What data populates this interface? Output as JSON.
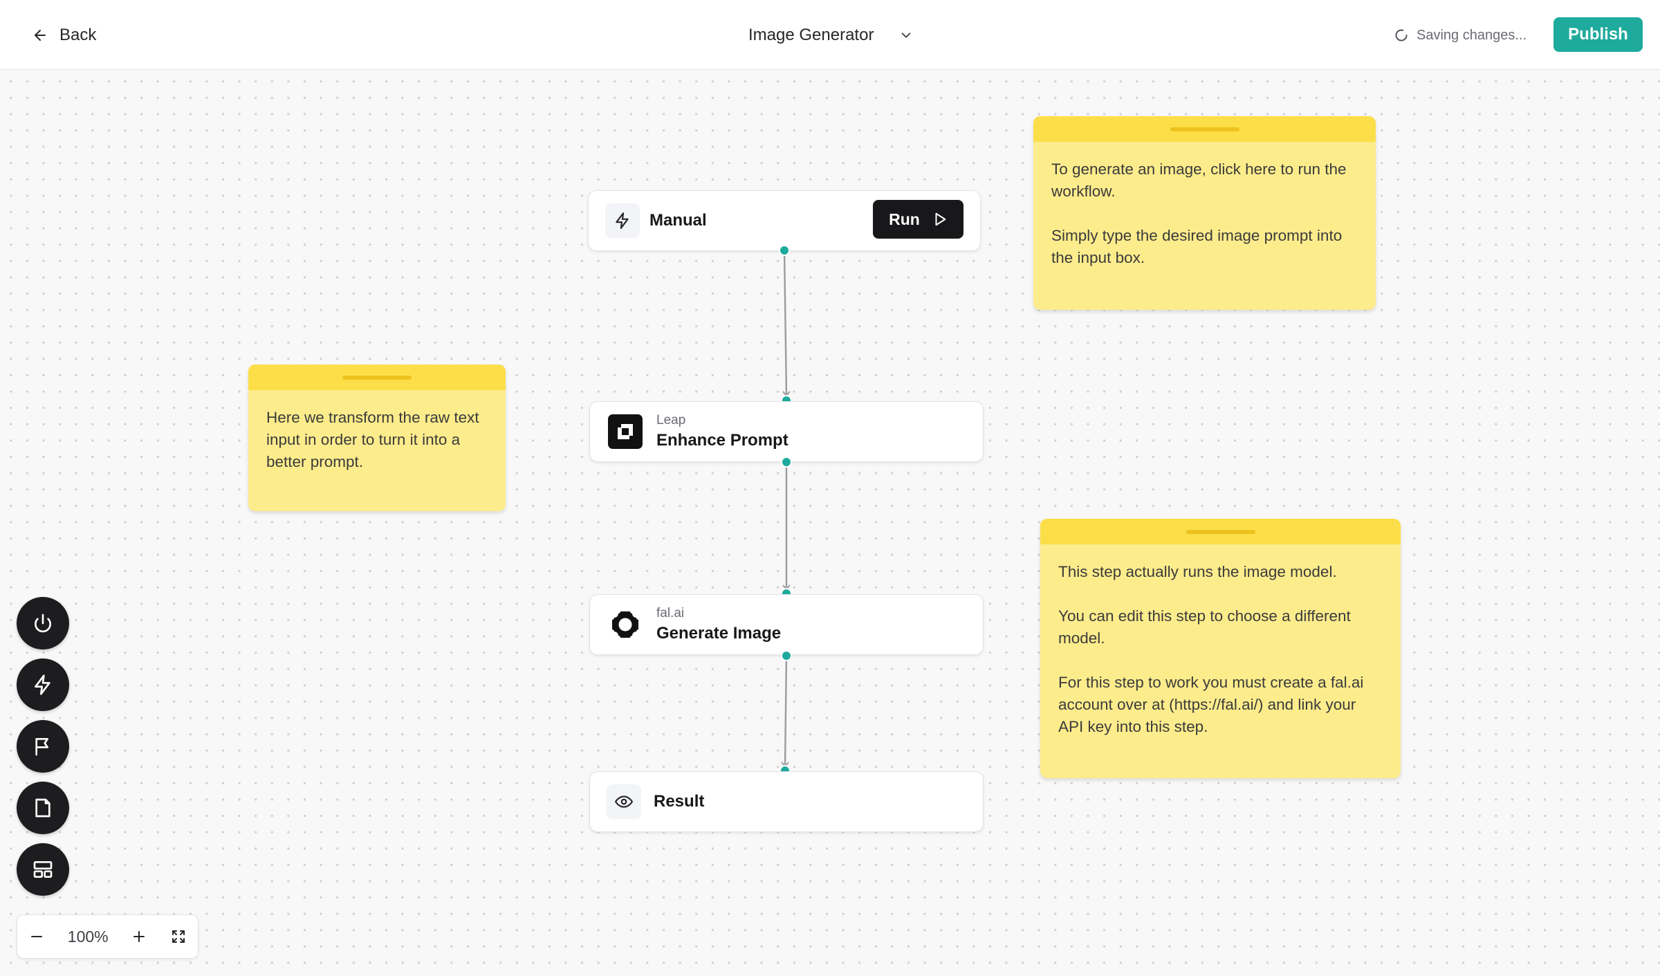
{
  "header": {
    "back_label": "Back",
    "workflow_title": "Image Generator",
    "status_text": "Saving changes...",
    "publish_label": "Publish"
  },
  "nodes": {
    "manual": {
      "label": "Manual",
      "run_label": "Run",
      "icon": "lightning-icon"
    },
    "enhance": {
      "provider": "Leap",
      "label": "Enhance Prompt",
      "icon": "leap-logo-icon"
    },
    "generate": {
      "provider": "fal.ai",
      "label": "Generate Image",
      "icon": "fal-logo-icon"
    },
    "result": {
      "label": "Result",
      "icon": "eye-icon"
    }
  },
  "notes": {
    "run_hint": "To generate an image, click here to run the workflow.\n\nSimply type the desired image prompt into the input box.",
    "transform_hint": "Here we transform the raw text input in order to turn it into a better prompt.",
    "model_hint": "This step actually runs the image model.\n\nYou can edit this step to choose a different model.\n\nFor this step to work you must create a fal.ai account over at (https://fal.ai/) and link your API key into this step."
  },
  "toolbar": {
    "items": [
      "power-icon",
      "lightning-icon",
      "flag-icon",
      "note-icon",
      "layout-icon"
    ]
  },
  "zoom": {
    "level": "100%"
  },
  "colors": {
    "accent": "#1eaa9c",
    "sticky_body": "#fdec8c",
    "sticky_header": "#fcde48",
    "dark": "#18181b"
  }
}
